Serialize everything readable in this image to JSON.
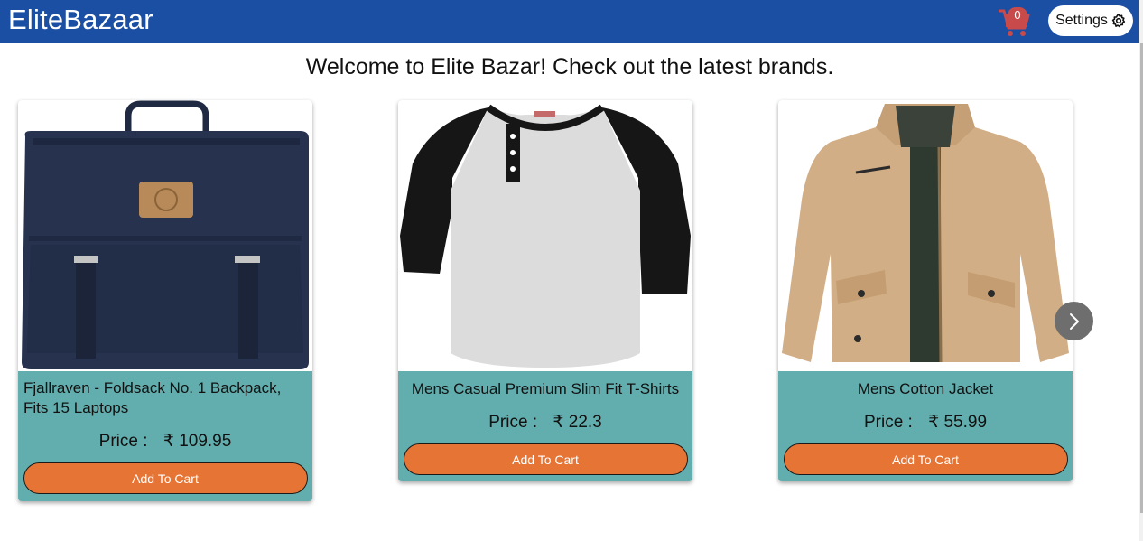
{
  "app": {
    "brand": "EliteBazaar"
  },
  "header": {
    "cart_count": "0",
    "settings_label": "Settings"
  },
  "welcome": "Welcome to Elite Bazar! Check out the latest brands.",
  "products": [
    {
      "title": "Fjallraven - Foldsack No. 1 Backpack, Fits 15 Laptops",
      "price_label": "Price :",
      "currency": "₹",
      "price": "109.95",
      "button": "Add To Cart",
      "image": "backpack"
    },
    {
      "title": "Mens Casual Premium Slim Fit T-Shirts",
      "price_label": "Price :",
      "currency": "₹",
      "price": "22.3",
      "button": "Add To Cart",
      "image": "t-shirt"
    },
    {
      "title": "Mens Cotton Jacket",
      "price_label": "Price :",
      "currency": "₹",
      "price": "55.99",
      "button": "Add To Cart",
      "image": "jacket"
    }
  ],
  "colors": {
    "navbar": "#1a4fa3",
    "card_body": "#62aeae",
    "button": "#e67535",
    "cart_icon": "#c94a4a"
  }
}
